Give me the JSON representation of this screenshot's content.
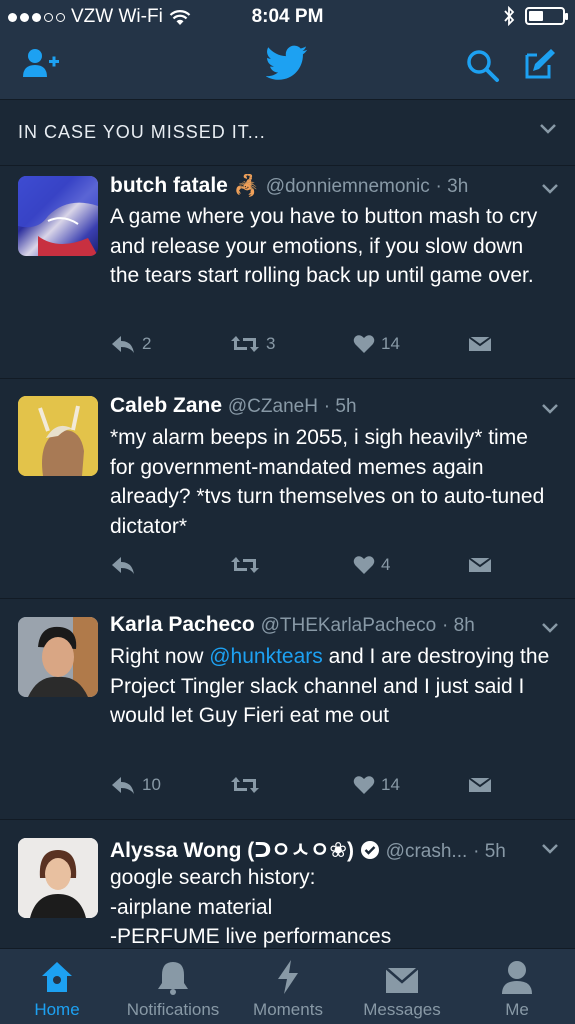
{
  "status_bar": {
    "carrier": "VZW Wi-Fi",
    "time": "8:04 PM"
  },
  "section_header": "IN CASE YOU MISSED IT...",
  "colors": {
    "background": "#1b2836",
    "bar": "#243447",
    "accent": "#1da1f2",
    "muted": "#8899a6"
  },
  "tweets": [
    {
      "name": "butch fatale",
      "emoji": "🦂",
      "handle": "@donniemnemonic",
      "time": "· 3h",
      "text": "A game where you have to  button mash to cry and release your emotions, if you slow down the tears start rolling back up until game over.",
      "replies": "2",
      "retweets": "3",
      "likes": "14"
    },
    {
      "name": "Caleb Zane",
      "handle": "@CZaneH",
      "time": "· 5h",
      "text": "*my alarm beeps in 2055, i sigh heavily* time for government-mandated memes again already? *tvs turn themselves on to auto-tuned dictator*",
      "replies": "",
      "retweets": "",
      "likes": "4"
    },
    {
      "name": "Karla Pacheco",
      "handle": "@THEKarlaPacheco",
      "time": "· 8h",
      "text_before": "Right now ",
      "mention": "@hunktears",
      "text_after": " and I are destroying the Project Tingler slack channel and I just said I would let Guy Fieri eat me out",
      "replies": "10",
      "retweets": "",
      "likes": "14"
    },
    {
      "name": "Alyssa Wong (ᑐㅇㅅㅇ❀)",
      "handle": "@crash...",
      "time": "· 5h",
      "text_lines": [
        "google search history:",
        "-airplane material",
        "-PERFUME live performances"
      ]
    }
  ],
  "tabs": [
    {
      "label": "Home",
      "icon": "home-icon",
      "active": true
    },
    {
      "label": "Notifications",
      "icon": "bell-icon"
    },
    {
      "label": "Moments",
      "icon": "lightning-icon"
    },
    {
      "label": "Messages",
      "icon": "envelope-icon"
    },
    {
      "label": "Me",
      "icon": "person-icon"
    }
  ]
}
